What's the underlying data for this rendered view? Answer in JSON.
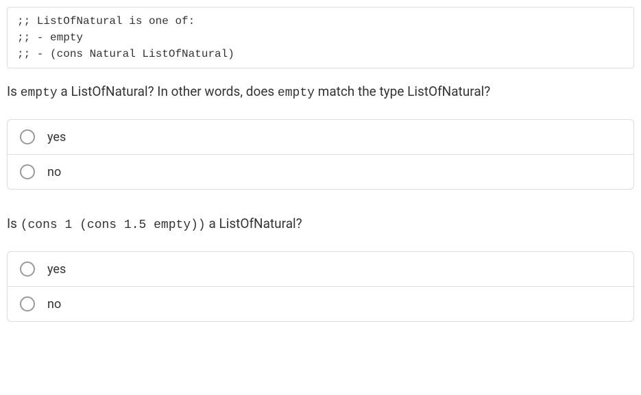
{
  "code_block": ";; ListOfNatural is one of:\n;; - empty\n;; - (cons Natural ListOfNatural)",
  "questions": [
    {
      "prefix": "Is ",
      "code1": "empty",
      "mid": " a ListOfNatural? In other words, does ",
      "code2": "empty",
      "suffix": " match the type ListOfNatural?",
      "options": [
        "yes",
        "no"
      ]
    },
    {
      "prefix": "Is ",
      "code1": "(cons 1 (cons 1.5 empty))",
      "mid": " a ListOfNatural?",
      "code2": "",
      "suffix": "",
      "options": [
        "yes",
        "no"
      ]
    }
  ]
}
